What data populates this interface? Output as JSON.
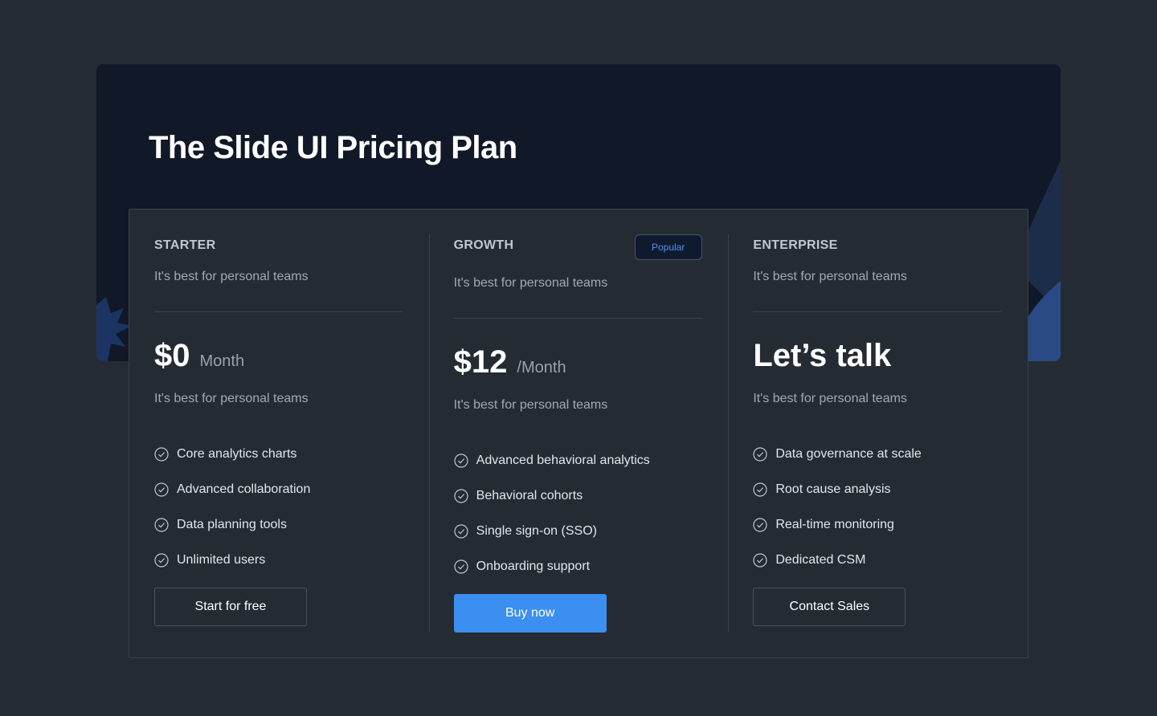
{
  "hero": {
    "title": "The Slide UI Pricing Plan"
  },
  "plans": [
    {
      "name": "STARTER",
      "description": "It's best for personal teams",
      "price": "$0",
      "period": "Month",
      "price_description": "It's best for personal teams",
      "features": [
        "Core analytics charts",
        "Advanced collaboration",
        "Data planning tools",
        "Unlimited users"
      ],
      "button": "Start for free"
    },
    {
      "name": "GROWTH",
      "badge": "Popular",
      "description": "It's best for personal teams",
      "price": "$12",
      "period": "/Month",
      "price_description": "It's best for personal teams",
      "features": [
        "Advanced behavioral analytics",
        "Behavioral cohorts",
        "Single sign-on (SSO)",
        "Onboarding support"
      ],
      "button": "Buy now"
    },
    {
      "name": "ENTERPRISE",
      "description": "It's best for personal teams",
      "price": "Let’s talk",
      "price_description": "It's best for personal teams",
      "features": [
        "Data governance at scale",
        "Root cause analysis",
        "Real-time monitoring",
        "Dedicated CSM"
      ],
      "button": "Contact Sales"
    }
  ],
  "icons": {
    "feature": "check-circle-icon"
  },
  "colors": {
    "background": "#252b33",
    "hero": "#111827",
    "accent": "#3b8ff0",
    "badge_text": "#4a96f0"
  }
}
